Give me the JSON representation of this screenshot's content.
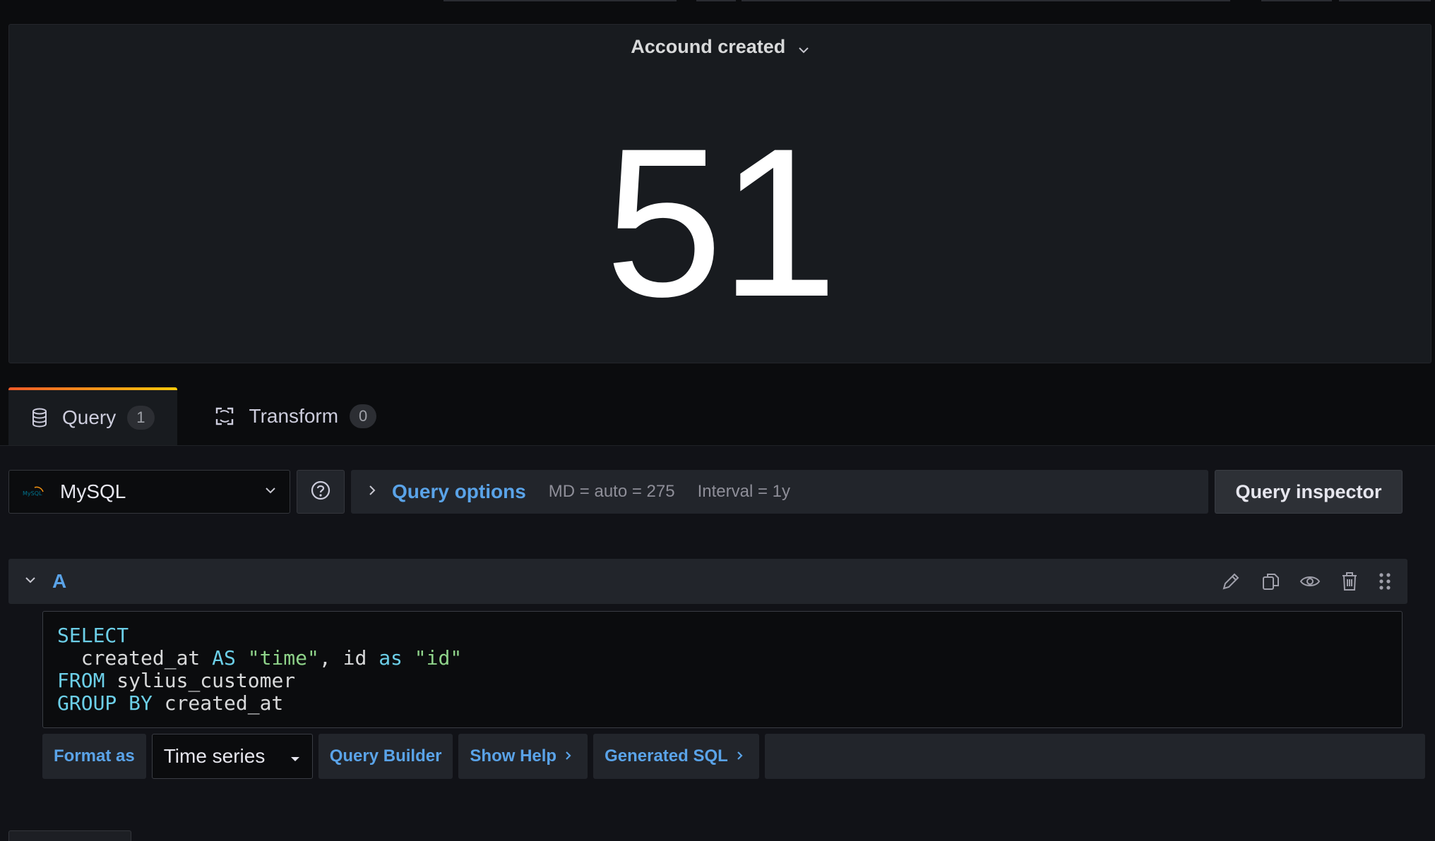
{
  "panel": {
    "title": "Accound created",
    "value": "51"
  },
  "tabs": [
    {
      "label": "Query",
      "count": "1",
      "icon": "database-icon"
    },
    {
      "label": "Transform",
      "count": "0",
      "icon": "transform-icon"
    }
  ],
  "datasource": {
    "name": "MySQL",
    "logo": "mysql-logo"
  },
  "query_options": {
    "label": "Query options",
    "md": "MD = auto = 275",
    "interval": "Interval = 1y"
  },
  "inspector_label": "Query inspector",
  "query": {
    "ref_id": "A",
    "actions": [
      "edit-icon",
      "duplicate-icon",
      "eye-icon",
      "trash-icon",
      "drag-handle-icon"
    ]
  },
  "sql": {
    "l1_kw": "SELECT",
    "l2_a": "  created_at ",
    "l2_kw1": "AS",
    "l2_b": " ",
    "l2_str1": "\"time\"",
    "l2_c": ", id ",
    "l2_kw2": "as",
    "l2_d": " ",
    "l2_str2": "\"id\"",
    "l3_kw": "FROM",
    "l3_rest": " sylius_customer",
    "l4_kw": "GROUP BY",
    "l4_rest": " created_at"
  },
  "footer": {
    "format_label": "Format as",
    "format_value": "Time series",
    "builder_label": "Query Builder",
    "help_label": "Show Help",
    "generated_label": "Generated SQL"
  },
  "colors": {
    "accent": "#5aa3e8",
    "tab_gradient_start": "#f05a28",
    "tab_gradient_end": "#fbca0a"
  }
}
